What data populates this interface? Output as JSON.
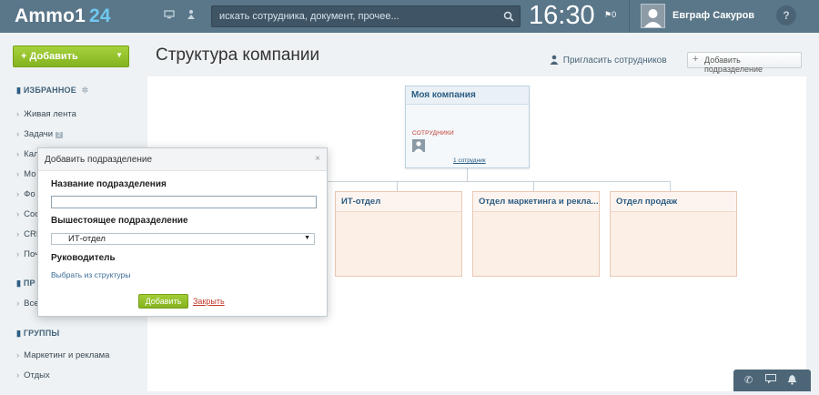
{
  "header": {
    "logo_text": "Ammo1",
    "logo_num": "24",
    "search_placeholder": "искать сотрудника, документ, прочее...",
    "clock": "16:30",
    "flag_count": "0",
    "user_name": "Евграф Сакуров",
    "help": "?"
  },
  "sidebar": {
    "add_label": "Добавить",
    "favorites_title": "ИЗБРАННОЕ",
    "items": [
      {
        "label": "Живая лента"
      },
      {
        "label": "Задачи",
        "badge": "2"
      },
      {
        "label": "Кал"
      },
      {
        "label": "Мо"
      },
      {
        "label": "Фо"
      },
      {
        "label": "Сос"
      },
      {
        "label": "CRI"
      },
      {
        "label": "Поч"
      }
    ],
    "section2_title": "ПР",
    "section2_item": "Все",
    "groups_title": "ГРУППЫ",
    "groups": [
      {
        "label": "Маркетинг и реклама"
      },
      {
        "label": "Отдых"
      }
    ]
  },
  "main": {
    "title": "Структура компании",
    "invite_label": "Пригласить сотрудников",
    "add_dept_label": "Добавить подразделение",
    "company": {
      "name": "Моя компания",
      "employees_label": "СОТРУДНИКИ",
      "count_label": "1 сотрудник"
    },
    "departments": [
      {
        "name": "ИТ-отдел"
      },
      {
        "name": "Отдел маркетинга и рекла..."
      },
      {
        "name": "Отдел продаж"
      }
    ]
  },
  "dialog": {
    "title": "Добавить подразделение",
    "close_symbol": "×",
    "name_label": "Название подразделения",
    "name_value": "",
    "parent_label": "Вышестоящее подразделение",
    "parent_value": "ИТ-отдел",
    "head_label": "Руководитель",
    "choose_link": "Выбрать из структуры",
    "submit_label": "Добавить",
    "cancel_label": "Закрыть"
  }
}
